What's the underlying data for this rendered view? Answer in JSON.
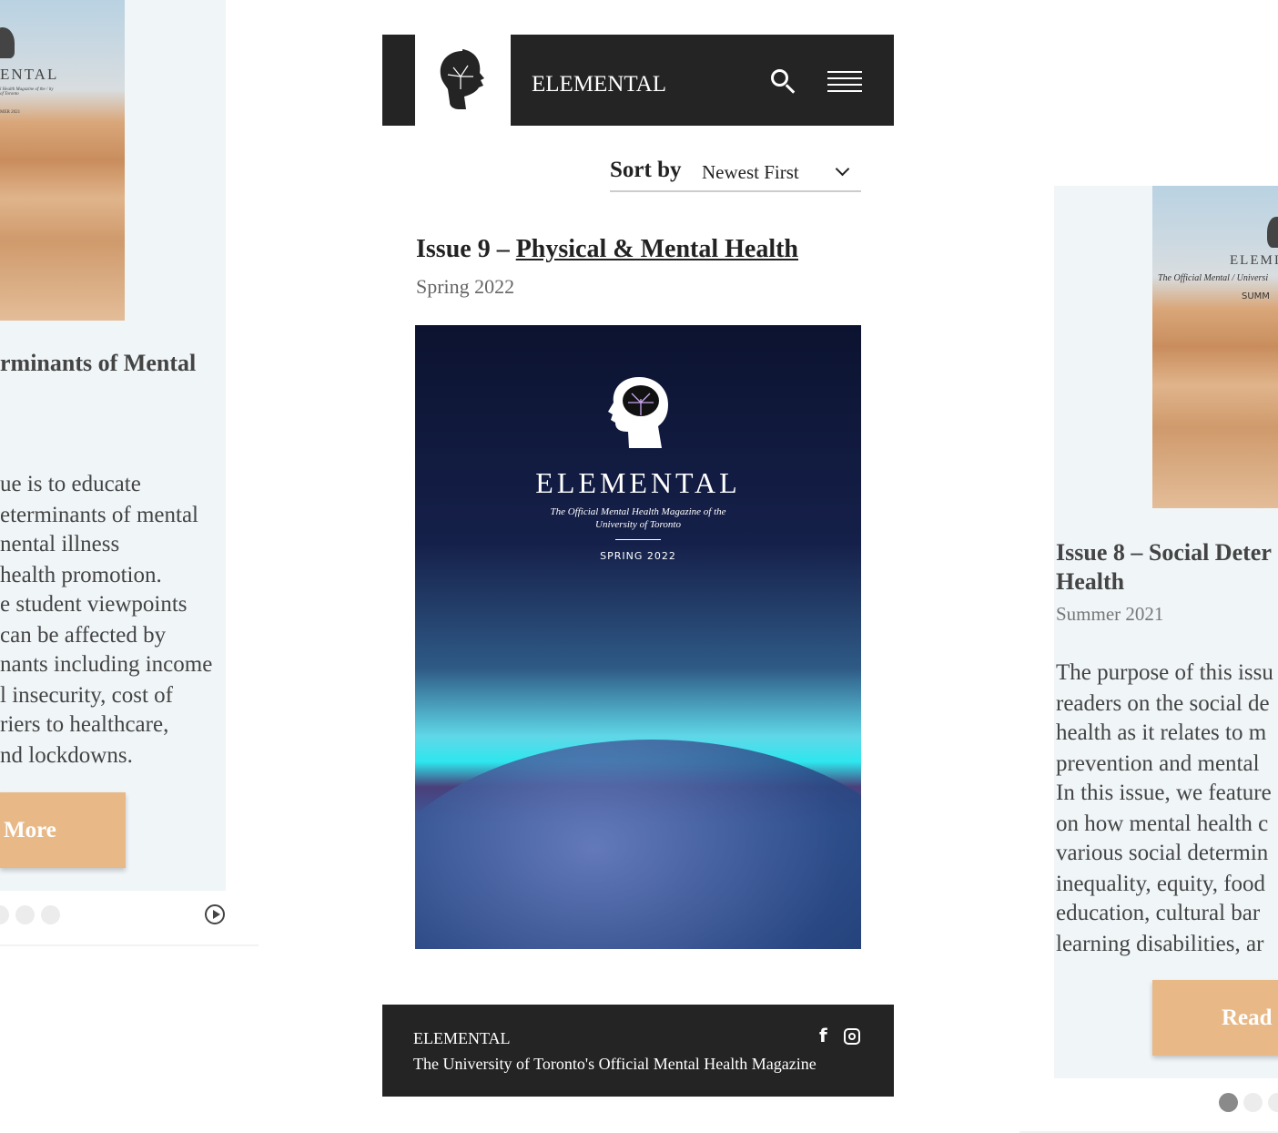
{
  "left_card": {
    "cover": {
      "brand": "ENTAL",
      "tagline": "l Health Magazine of the / ity of Toronto",
      "season": "MER 2021"
    },
    "title": "rminants of Mental",
    "body_lines": [
      "ue is to educate",
      "eterminants of mental",
      "nental illness",
      " health promotion.",
      "e student viewpoints",
      "can be affected by",
      "nants including income",
      "l insecurity, cost of",
      "riers to healthcare,",
      "nd lockdowns."
    ],
    "button": "More"
  },
  "header": {
    "brand": "ELEMENTAL"
  },
  "sort": {
    "label": "Sort by",
    "value": "Newest First"
  },
  "issue": {
    "prefix": "Issue 9 – ",
    "link": "Physical & Mental Health",
    "date": "Spring 2022",
    "cover": {
      "brand": "ELEMENTAL",
      "tagline1": "The Official Mental Health Magazine of the",
      "tagline2": "University of Toronto",
      "season": "SPRING 2022"
    }
  },
  "footer": {
    "brand": "ELEMENTAL",
    "tagline": "The University of Toronto's Official Mental Health Magazine"
  },
  "right_card": {
    "cover": {
      "brand": "ELEMI",
      "tagline": "The Official Mental / Universi",
      "season": "SUMM"
    },
    "title_line1": "Issue 8 – Social Deter",
    "title_line2": "Health",
    "date": "Summer 2021",
    "body_lines": [
      "The purpose of this issu",
      "readers on the social de",
      "health as it relates to m",
      "prevention and mental",
      "In this issue, we feature",
      "on how mental health c",
      "various social determin",
      "inequality, equity, food",
      "education, cultural bar",
      "learning disabilities, ar"
    ],
    "button": "Read"
  },
  "colors": {
    "accent": "#e8b886",
    "dark": "#242424",
    "card": "#f0f5f8"
  }
}
